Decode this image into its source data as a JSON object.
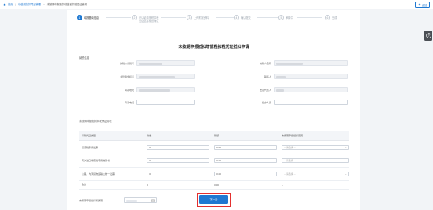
{
  "breadcrumb": {
    "home": "首页",
    "items": [
      "增值税抵扣凭证管理",
      "未按期申报抵扣增值税扣税凭证管理"
    ]
  },
  "back_label": "返回",
  "steps": [
    {
      "num": "1",
      "label": "填报基础信息",
      "active": true
    },
    {
      "num": "2",
      "label": "已认证增值税扣税凭证信息核查确认",
      "active": false
    },
    {
      "num": "3",
      "label": "上传附报资料",
      "active": false
    },
    {
      "num": "4",
      "label": "确认提交",
      "active": false
    },
    {
      "num": "5",
      "label": "审核中",
      "active": false
    },
    {
      "num": "6",
      "label": "完成",
      "active": false
    }
  ],
  "title": "未按期申报抵扣增值税扣税凭证抵扣申请",
  "basic_section": "纳税信息",
  "basic_fields": {
    "taxpayer_id_label": "纳税人识别号",
    "taxpayer_name_label": "纳税人名称",
    "tax_authority_label": "主管税务机关",
    "contact_label": "联系人",
    "address_label": "联系地址",
    "legal_rep_label": "法定代表人",
    "phone_label": "联系电话",
    "handler_label": "经办人员"
  },
  "vouchers_section": "未按期申报抵扣扣税凭证情况",
  "table": {
    "headers": [
      "扣税凭证类型",
      "份数",
      "税额",
      "未按期申报抵扣原因"
    ],
    "rows": [
      {
        "type": "增值税专用发票",
        "count": "0",
        "tax": "0.00",
        "reason_placeholder": "-- 请选择 --"
      },
      {
        "type": "海关进口增值税专用缴款书",
        "count": "0",
        "tax": "0.00",
        "reason_placeholder": "-- 请选择 --"
      },
      {
        "type": "公路、内河货物运输业统一发票",
        "count": "0",
        "tax": "0.00",
        "reason_placeholder": "-- 请选择 --"
      }
    ],
    "total": {
      "label": "合计",
      "count": "0",
      "tax": "0.00",
      "reason": "--"
    }
  },
  "period_label": "未按期申报抵扣所属期",
  "next_label": "下一步"
}
